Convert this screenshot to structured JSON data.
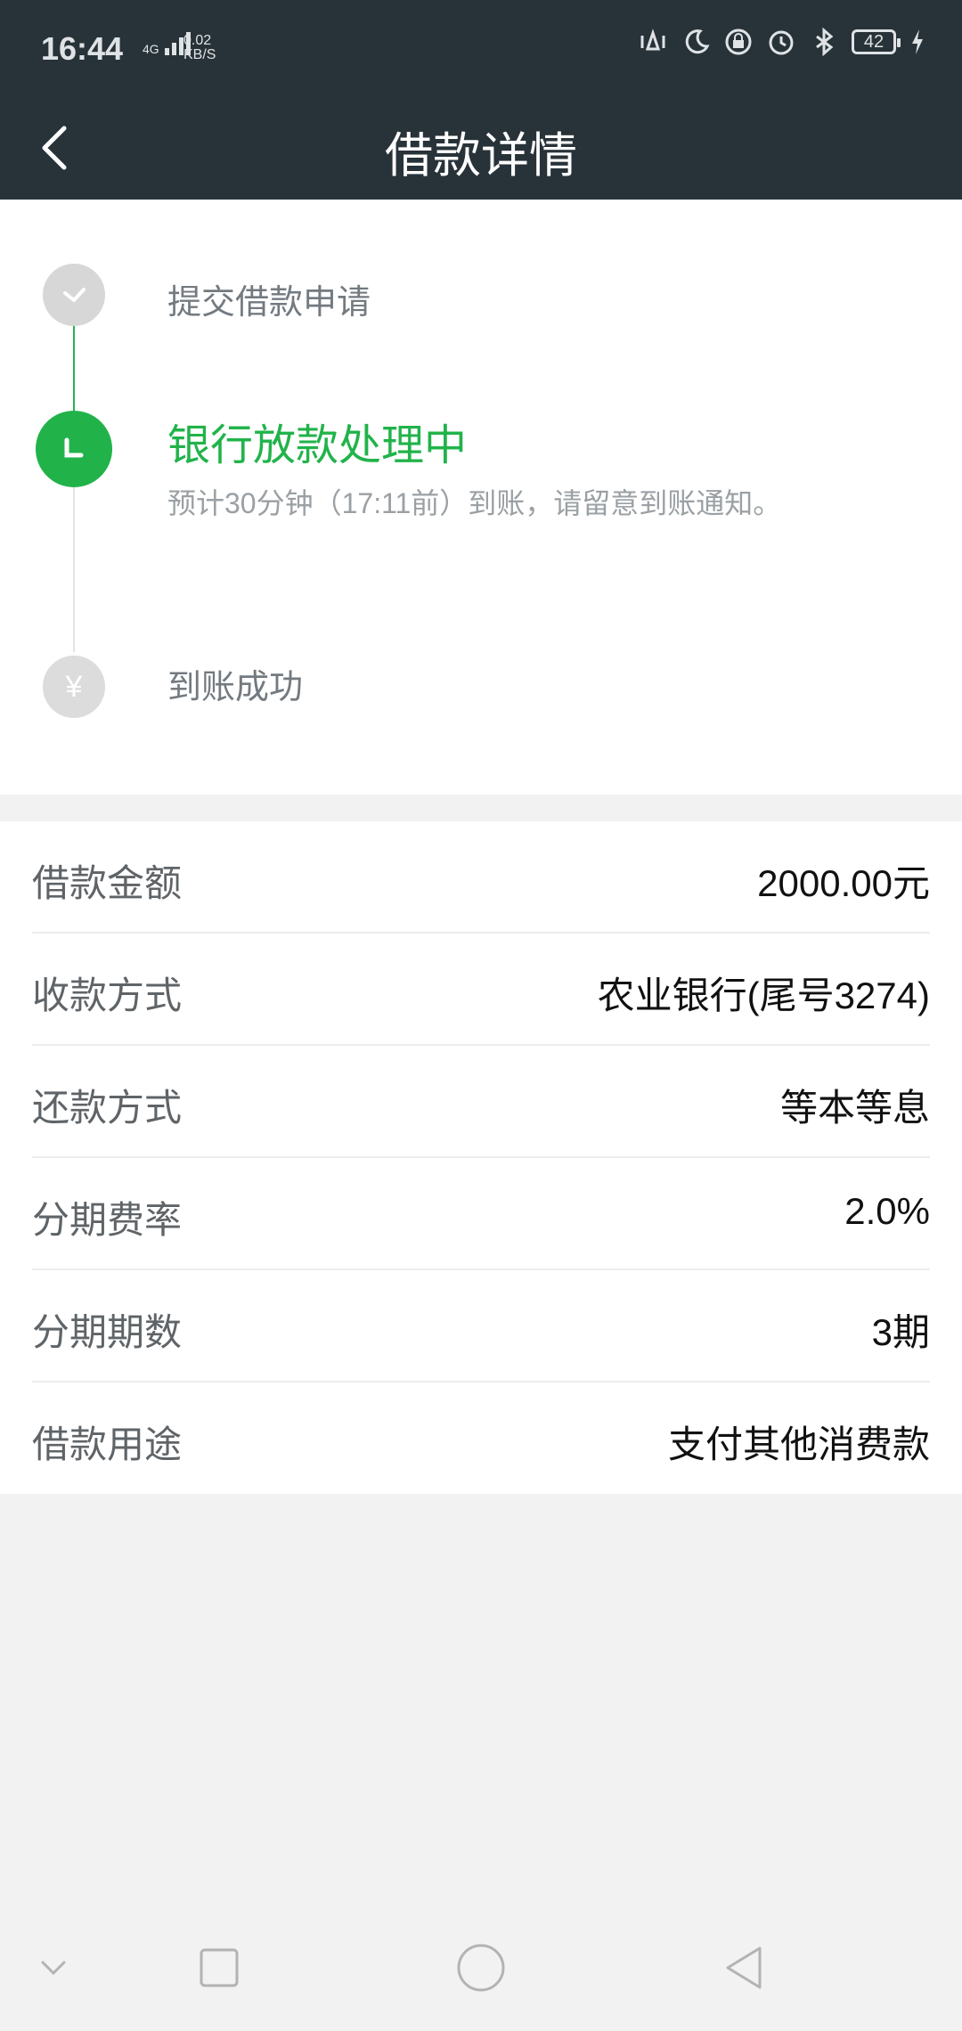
{
  "status_bar": {
    "time": "16:44",
    "network_type": "4G",
    "speed_value": "0.02",
    "speed_unit": "KB/S",
    "battery": "42"
  },
  "header": {
    "title": "借款详情"
  },
  "timeline": {
    "steps": [
      {
        "label": "提交借款申请",
        "state": "done"
      },
      {
        "label": "银行放款处理中",
        "state": "active",
        "note": "预计30分钟（17:11前）到账，请留意到账通知。"
      },
      {
        "label": "到账成功",
        "state": "pending",
        "icon_glyph": "¥"
      }
    ]
  },
  "details": [
    {
      "label": "借款金额",
      "value": "2000.00元"
    },
    {
      "label": "收款方式",
      "value": "农业银行(尾号3274)"
    },
    {
      "label": "还款方式",
      "value": "等本等息"
    },
    {
      "label": "分期费率",
      "value": "2.0%"
    },
    {
      "label": "分期期数",
      "value": "3期"
    },
    {
      "label": "借款用途",
      "value": "支付其他消费款"
    }
  ],
  "colors": {
    "header_bg": "#283339",
    "accent_green": "#21b34a",
    "page_bg": "#f2f2f2"
  },
  "icons": [
    "back-arrow-icon",
    "check-icon",
    "clock-icon",
    "yuan-icon",
    "nav-collapse-icon",
    "nav-recents-icon",
    "nav-home-icon",
    "nav-back-icon"
  ]
}
